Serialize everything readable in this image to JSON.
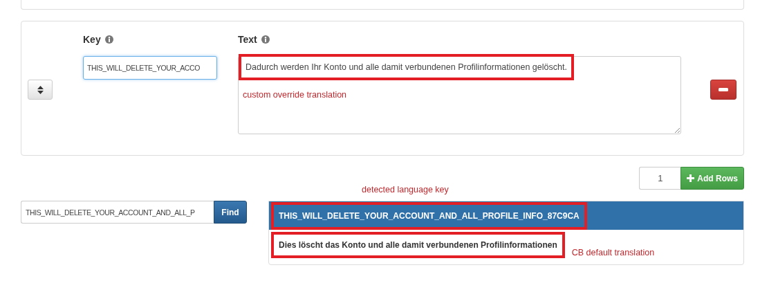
{
  "rows": [
    {
      "key_label": "Key",
      "text_label": "Text",
      "key_value": "THIS_WILL_DELETE_YOUR_ACCO",
      "text_value": "Dadurch werden Ihr Konto und alle damit verbundenen Profilinformationen gelöscht.",
      "text_highlighted": true,
      "note": "custom override translation"
    }
  ],
  "add_rows": {
    "count": "1",
    "button": "Add Rows"
  },
  "search": {
    "value": "THIS_WILL_DELETE_YOUR_ACCOUNT_AND_ALL_P",
    "button": "Find"
  },
  "result": {
    "key": "THIS_WILL_DELETE_YOUR_ACCOUNT_AND_ALL_PROFILE_INFO_87C9CA",
    "key_highlighted": true,
    "key_note": "detected language key",
    "translation": "Dies löscht das Konto und alle damit verbundenen Profilinformationen",
    "translation_highlighted": true,
    "translation_note": "CB default translation"
  }
}
